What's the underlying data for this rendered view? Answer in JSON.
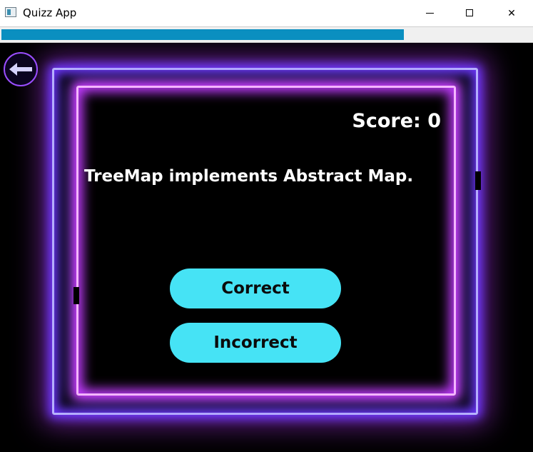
{
  "window": {
    "title": "Quizz App",
    "icon": "app-window-icon"
  },
  "controls": {
    "minimize": "minimize-icon",
    "maximize": "maximize-icon",
    "close": "close-icon",
    "close_glyph": "✕"
  },
  "progress": {
    "fraction": 0.755,
    "color": "#0a8fc0"
  },
  "back": {
    "icon": "back-arrow-icon"
  },
  "score": {
    "text": "Score: 0"
  },
  "question": {
    "text": "TreeMap implements Abstract Map."
  },
  "answers": {
    "correct": "Correct",
    "incorrect": "Incorrect"
  },
  "colors": {
    "button": "#46e3f5",
    "glow_outer": "#6d36ff",
    "glow_inner": "#d13cff",
    "background": "#000000"
  }
}
